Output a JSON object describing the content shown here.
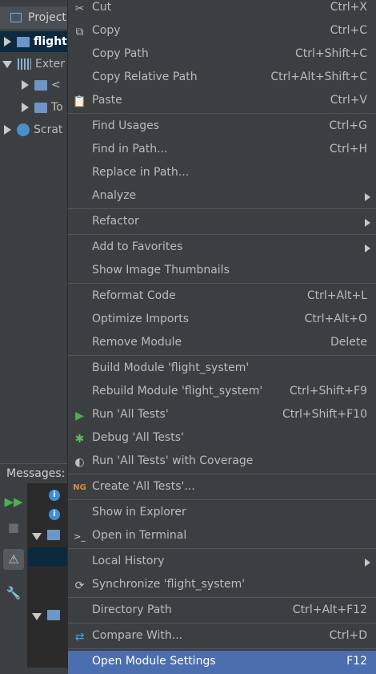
{
  "project_panel": {
    "title": "Project",
    "tree": [
      {
        "label": "flight",
        "expanded": false,
        "icon": "module-folder-icon"
      },
      {
        "label": "Exter",
        "expanded": true,
        "icon": "library-icon"
      },
      {
        "label": "<",
        "expanded": false,
        "icon": "folder-icon"
      },
      {
        "label": "To",
        "expanded": false,
        "icon": "folder-icon"
      },
      {
        "label": "Scrat",
        "expanded": false,
        "icon": "scratches-icon"
      }
    ]
  },
  "messages_panel": {
    "title": "Messages:"
  },
  "context_menu": {
    "items": [
      {
        "label": "Cut",
        "shortcut": "Ctrl+X",
        "icon": "cut-icon"
      },
      {
        "label": "Copy",
        "shortcut": "Ctrl+C",
        "icon": "copy-icon"
      },
      {
        "label": "Copy Path",
        "shortcut": "Ctrl+Shift+C"
      },
      {
        "label": "Copy Relative Path",
        "shortcut": "Ctrl+Alt+Shift+C"
      },
      {
        "label": "Paste",
        "shortcut": "Ctrl+V",
        "icon": "paste-icon"
      },
      {
        "label": "Find Usages",
        "shortcut": "Ctrl+G"
      },
      {
        "label": "Find in Path...",
        "shortcut": "Ctrl+H"
      },
      {
        "label": "Replace in Path...",
        "shortcut": ""
      },
      {
        "label": "Analyze",
        "shortcut": "",
        "submenu": true
      },
      {
        "label": "Refactor",
        "shortcut": "",
        "submenu": true
      },
      {
        "label": "Add to Favorites",
        "shortcut": "",
        "submenu": true
      },
      {
        "label": "Show Image Thumbnails",
        "shortcut": ""
      },
      {
        "label": "Reformat Code",
        "shortcut": "Ctrl+Alt+L"
      },
      {
        "label": "Optimize Imports",
        "shortcut": "Ctrl+Alt+O"
      },
      {
        "label": "Remove Module",
        "shortcut": "Delete"
      },
      {
        "label": "Build Module 'flight_system'",
        "shortcut": ""
      },
      {
        "label": "Rebuild Module 'flight_system'",
        "shortcut": "Ctrl+Shift+F9"
      },
      {
        "label": "Run 'All Tests'",
        "shortcut": "Ctrl+Shift+F10",
        "icon": "run-icon"
      },
      {
        "label": "Debug 'All Tests'",
        "shortcut": "",
        "icon": "debug-icon"
      },
      {
        "label": "Run 'All Tests' with Coverage",
        "shortcut": "",
        "icon": "coverage-icon"
      },
      {
        "label": "Create 'All Tests'...",
        "shortcut": "",
        "icon": "testng-icon"
      },
      {
        "label": "Show in Explorer",
        "shortcut": ""
      },
      {
        "label": "Open in Terminal",
        "shortcut": "",
        "icon": "terminal-icon"
      },
      {
        "label": "Local History",
        "shortcut": "",
        "submenu": true
      },
      {
        "label": "Synchronize 'flight_system'",
        "shortcut": "",
        "icon": "sync-icon"
      },
      {
        "label": "Directory Path",
        "shortcut": "Ctrl+Alt+F12"
      },
      {
        "label": "Compare With...",
        "shortcut": "Ctrl+D",
        "icon": "compare-icon"
      },
      {
        "label": "Open Module Settings",
        "shortcut": "F12"
      }
    ]
  },
  "colors": {
    "background": "#3c3f41",
    "selection": "#4b6eaf",
    "tree_selection": "#0d293e",
    "run_green": "#4caf50",
    "info_blue": "#3d8ed6"
  }
}
